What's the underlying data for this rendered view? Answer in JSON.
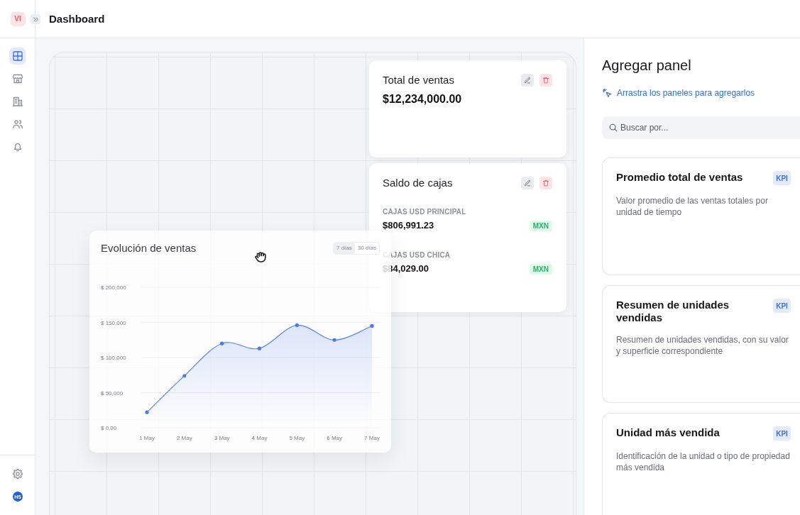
{
  "header": {
    "workspace_badge": "VI",
    "title": "Dashboard"
  },
  "sidebar": {
    "items": [
      {
        "kind": "grid",
        "selected": true
      },
      {
        "kind": "store",
        "selected": false
      },
      {
        "kind": "buildings",
        "selected": false
      },
      {
        "kind": "users",
        "selected": false
      },
      {
        "kind": "bell",
        "selected": false
      }
    ],
    "user_avatar": "HS"
  },
  "canvas": {
    "widgets": [
      {
        "kind": "kpi",
        "title": "Total de ventas",
        "value": "$12,234,000.00"
      },
      {
        "kind": "balances",
        "title": "Saldo de cajas",
        "accounts": [
          {
            "label": "CAJAS USD PRINCIPAL",
            "amount": "$806,991.23",
            "currency": "MXN"
          },
          {
            "label": "CAJAS USD CHICA",
            "amount": "$84,029.00",
            "currency": "MXN"
          }
        ]
      },
      {
        "kind": "chart",
        "title": "Evolución de ventas",
        "dragging": true,
        "ranges": [
          {
            "label": "7 días",
            "selected": true
          },
          {
            "label": "30 días",
            "selected": false
          }
        ],
        "chart_data": {
          "type": "area",
          "categories": [
            "1 May",
            "2 May",
            "3 May",
            "4 May",
            "5 May",
            "6 May",
            "7 May"
          ],
          "values": [
            22000,
            74000,
            120000,
            113000,
            146000,
            125000,
            145000
          ],
          "ylim": [
            0,
            200000
          ],
          "yticks": [
            {
              "value": 0,
              "label": "$ 0,00"
            },
            {
              "value": 50000,
              "label": "$ 50,000"
            },
            {
              "value": 100000,
              "label": "$ 100,000"
            },
            {
              "value": 150000,
              "label": "$ 150,000"
            },
            {
              "value": 200000,
              "label": "$ 200,000"
            }
          ],
          "grid": true
        }
      }
    ]
  },
  "add_panel": {
    "title": "Agregar panel",
    "hint": "Arrastra los paneles para agregarlos",
    "search": {
      "placeholder": "Buscar por..."
    },
    "panels": [
      {
        "title": "Promedio total de ventas",
        "tag": "KPI",
        "description": "Valor promedio de las ventas totales por unidad de tiempo"
      },
      {
        "title": "Resumen de unidades vendidas",
        "tag": "KPI",
        "description": "Resumen de unidades vendidas, con su valor y superficie correspondiente"
      },
      {
        "title": "Unidad más vendida",
        "tag": "KPI",
        "description": "Identificación de la unidad o tipo de propiedad más vendida"
      }
    ]
  }
}
